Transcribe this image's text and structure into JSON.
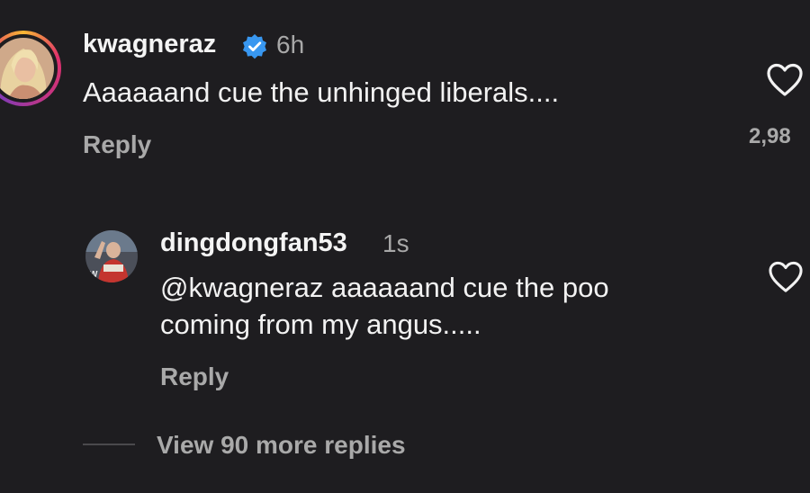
{
  "comment": {
    "username": "kwagneraz",
    "verified_icon": "verified-badge-icon",
    "time": "6h",
    "text": "Aaaaaand cue the unhinged liberals....",
    "reply_label": "Reply",
    "like_count": "2,98",
    "like_icon": "heart-outline-icon"
  },
  "reply": {
    "username": "dingdongfan53",
    "time": "1s",
    "text_line1": "@kwagneraz aaaaaand cue the poo",
    "text_line2": "coming from my angus.....",
    "reply_label": "Reply",
    "like_icon": "heart-outline-icon"
  },
  "view_more_label": "View 90 more replies",
  "colors": {
    "background": "#1e1d20",
    "verified_blue": "#3897f0",
    "muted_text": "#a9a9a9"
  }
}
